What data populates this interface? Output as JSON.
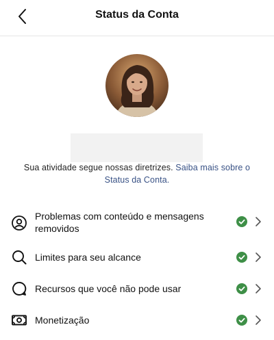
{
  "header": {
    "title": "Status da Conta"
  },
  "intro": {
    "text": "Sua atividade segue nossas diretrizes. ",
    "link": "Saiba mais sobre o Status da Conta."
  },
  "items": [
    {
      "label": "Problemas com conteúdo e mensagens removidos",
      "icon": "user-circle-icon",
      "status": "ok"
    },
    {
      "label": "Limites para seu alcance",
      "icon": "search-icon",
      "status": "ok"
    },
    {
      "label": "Recursos que você não pode usar",
      "icon": "speech-bubble-icon",
      "status": "ok"
    },
    {
      "label": "Monetização",
      "icon": "banknote-icon",
      "status": "ok"
    }
  ],
  "colors": {
    "check": "#3e8f47",
    "link": "#385185"
  }
}
